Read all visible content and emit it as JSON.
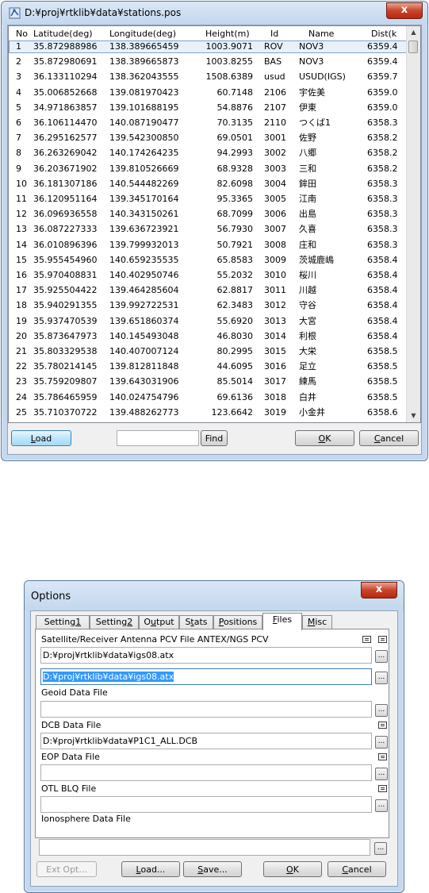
{
  "stations_dialog": {
    "title": "D:¥proj¥rtklib¥data¥stations.pos",
    "close_glyph": "x",
    "columns": [
      "No",
      "Latitude(deg)",
      "Longitude(deg)",
      "Height(m)",
      "Id",
      "Name",
      "Dist(k"
    ],
    "rows": [
      [
        "1",
        "35.872988986",
        "138.389665459",
        "1003.9071",
        "ROV",
        "NOV3",
        "6359.4"
      ],
      [
        "2",
        "35.872980691",
        "138.389665873",
        "1003.8255",
        "BAS",
        "NOV3",
        "6359.4"
      ],
      [
        "3",
        "36.133110294",
        "138.362043555",
        "1508.6389",
        "usud",
        "USUD(IGS)",
        "6359.7"
      ],
      [
        "4",
        "35.006852668",
        "139.081970423",
        "60.7148",
        "2106",
        "宇佐美",
        "6359.0"
      ],
      [
        "5",
        "34.971863857",
        "139.101688195",
        "54.8876",
        "2107",
        "伊東",
        "6359.0"
      ],
      [
        "6",
        "36.106114470",
        "140.087190477",
        "70.3135",
        "2110",
        "つくば1",
        "6358.3"
      ],
      [
        "7",
        "36.295162577",
        "139.542300850",
        "69.0501",
        "3001",
        "佐野",
        "6358.2"
      ],
      [
        "8",
        "36.263269042",
        "140.174264235",
        "94.2993",
        "3002",
        "八郷",
        "6358.2"
      ],
      [
        "9",
        "36.203671902",
        "139.810526669",
        "68.9328",
        "3003",
        "三和",
        "6358.2"
      ],
      [
        "10",
        "36.181307186",
        "140.544482269",
        "82.6098",
        "3004",
        "鉾田",
        "6358.3"
      ],
      [
        "11",
        "36.120951164",
        "139.345170164",
        "95.3365",
        "3005",
        "江南",
        "6358.3"
      ],
      [
        "12",
        "36.096936558",
        "140.343150261",
        "68.7099",
        "3006",
        "出島",
        "6358.3"
      ],
      [
        "13",
        "36.087227333",
        "139.636723921",
        "56.7930",
        "3007",
        "久喜",
        "6358.3"
      ],
      [
        "14",
        "36.010896396",
        "139.799932013",
        "50.7921",
        "3008",
        "庄和",
        "6358.3"
      ],
      [
        "15",
        "35.955454960",
        "140.659235535",
        "65.8583",
        "3009",
        "茨城鹿嶋",
        "6358.4"
      ],
      [
        "16",
        "35.970408831",
        "140.402950746",
        "55.2032",
        "3010",
        "桜川",
        "6358.4"
      ],
      [
        "17",
        "35.925504422",
        "139.464285604",
        "62.8817",
        "3011",
        "川越",
        "6358.4"
      ],
      [
        "18",
        "35.940291355",
        "139.992722531",
        "62.3483",
        "3012",
        "守谷",
        "6358.4"
      ],
      [
        "19",
        "35.937470539",
        "139.651860374",
        "55.6920",
        "3013",
        "大宮",
        "6358.4"
      ],
      [
        "20",
        "35.873647973",
        "140.145493048",
        "46.8030",
        "3014",
        "利根",
        "6358.4"
      ],
      [
        "21",
        "35.803329538",
        "140.407007124",
        "80.2995",
        "3015",
        "大栄",
        "6358.5"
      ],
      [
        "22",
        "35.780214145",
        "139.812811848",
        "44.6095",
        "3016",
        "足立",
        "6358.5"
      ],
      [
        "23",
        "35.759209807",
        "139.643031906",
        "85.5014",
        "3017",
        "練馬",
        "6358.5"
      ],
      [
        "24",
        "35.786465959",
        "140.024754796",
        "69.6136",
        "3018",
        "白井",
        "6358.5"
      ],
      [
        "25",
        "35.710370722",
        "139.488262773",
        "123.6642",
        "3019",
        "小金井",
        "6358.6"
      ]
    ],
    "buttons": {
      "load": {
        "ul": "L",
        "rest": "oad"
      },
      "find": "Find",
      "ok": {
        "ul": "O",
        "rest": "K"
      },
      "cancel": {
        "ul": "C",
        "rest": "ancel"
      }
    },
    "find_value": ""
  },
  "options_dialog": {
    "title": "Options",
    "close_glyph": "x",
    "tabs": [
      {
        "pre": "Setting",
        "ul": "1",
        "post": ""
      },
      {
        "pre": "Setting",
        "ul": "2",
        "post": ""
      },
      {
        "pre": "O",
        "ul": "u",
        "post": "tput"
      },
      {
        "pre": "S",
        "ul": "t",
        "post": "ats"
      },
      {
        "pre": "",
        "ul": "P",
        "post": "ositions"
      },
      {
        "pre": "",
        "ul": "F",
        "post": "iles"
      },
      {
        "pre": "",
        "ul": "M",
        "post": "isc"
      }
    ],
    "active_tab_index": 5,
    "files": {
      "antenna_label": "Satellite/Receiver Antenna PCV File ANTEX/NGS PCV",
      "antenna_sat_value": "D:¥proj¥rtklib¥data¥igs08.atx",
      "antenna_rcv_value": "D:¥proj¥rtklib¥data¥igs08.atx",
      "geoid_label": "Geoid Data File",
      "geoid_value": "",
      "dcb_label": "DCB Data File",
      "dcb_value": "D:¥proj¥rtklib¥data¥P1C1_ALL.DCB",
      "eop_label": "EOP Data File",
      "eop_value": "",
      "otl_label": "OTL BLQ File",
      "otl_value": "",
      "iono_label": "Ionosphere Data File",
      "iono_value": "",
      "browse_glyph": "..."
    },
    "buttons": {
      "ext_opt": "Ext Opt...",
      "load": {
        "ul": "L",
        "rest": "oad..."
      },
      "save": {
        "ul": "S",
        "rest": "ave..."
      },
      "ok": {
        "ul": "O",
        "rest": "K"
      },
      "cancel": {
        "ul": "C",
        "rest": "ancel"
      }
    }
  }
}
